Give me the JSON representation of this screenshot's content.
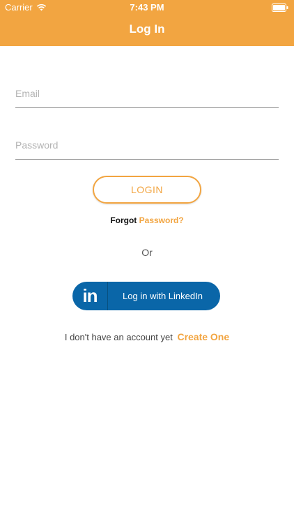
{
  "status_bar": {
    "carrier": "Carrier",
    "time": "7:43 PM",
    "wifi_icon": "wifi-icon",
    "battery_icon": "battery-icon"
  },
  "header": {
    "title": "Log In",
    "background_color": "#F2A541"
  },
  "form": {
    "email_placeholder": "Email",
    "email_value": "",
    "password_placeholder": "Password",
    "password_value": ""
  },
  "login_button": {
    "label": "LOGIN"
  },
  "forgot": {
    "text": "Forgot",
    "link": "Password?"
  },
  "divider_text": "Or",
  "linkedin": {
    "icon": "linkedin-icon",
    "icon_text": "in",
    "label": "Log in with LinkedIn",
    "color": "#0A66A8"
  },
  "signup": {
    "text": "I don't have an account yet",
    "link": "Create One"
  },
  "accent_color": "#F2A541"
}
